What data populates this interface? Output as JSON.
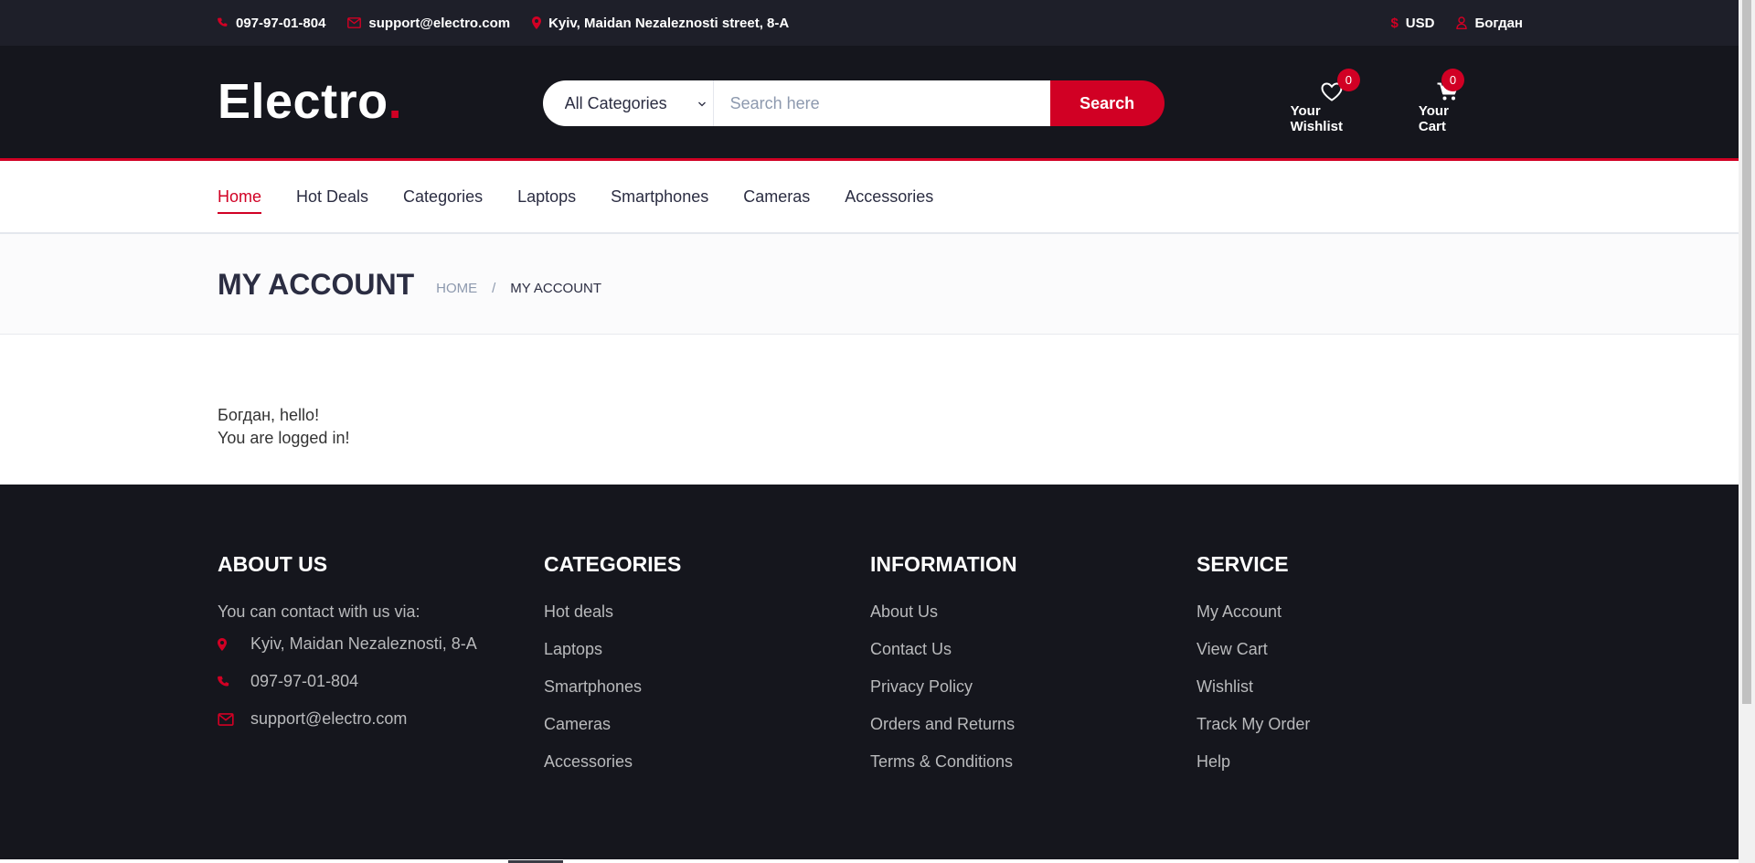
{
  "top_bar": {
    "phone": "097-97-01-804",
    "email": "support@electro.com",
    "address": "Kyiv, Maidan Nezaleznosti street, 8-A",
    "currency": "USD",
    "user": "Богдан"
  },
  "header": {
    "logo_text": "Electro",
    "logo_dot": ".",
    "search": {
      "category_selected": "All Categories",
      "placeholder": "Search here",
      "button_label": "Search"
    },
    "wishlist": {
      "label": "Your Wishlist",
      "count": "0"
    },
    "cart": {
      "label": "Your Cart",
      "count": "0"
    }
  },
  "nav": {
    "items": [
      {
        "label": "Home",
        "active": true
      },
      {
        "label": "Hot Deals"
      },
      {
        "label": "Categories"
      },
      {
        "label": "Laptops"
      },
      {
        "label": "Smartphones"
      },
      {
        "label": "Cameras"
      },
      {
        "label": "Accessories"
      }
    ]
  },
  "breadcrumb": {
    "title": "MY ACCOUNT",
    "home": "HOME",
    "separator": "/",
    "current": "MY ACCOUNT"
  },
  "main": {
    "greeting": "Богдан, hello!",
    "status": "You are logged in!"
  },
  "footer": {
    "about": {
      "title": "ABOUT US",
      "intro": "You can contact with us via:",
      "address": "Kyiv, Maidan Nezaleznosti, 8-A",
      "phone": "097-97-01-804",
      "email": "support@electro.com"
    },
    "categories": {
      "title": "CATEGORIES",
      "links": [
        "Hot deals",
        "Laptops",
        "Smartphones",
        "Cameras",
        "Accessories"
      ]
    },
    "information": {
      "title": "INFORMATION",
      "links": [
        "About Us",
        "Contact Us",
        "Privacy Policy",
        "Orders and Returns",
        "Terms & Conditions"
      ]
    },
    "service": {
      "title": "SERVICE",
      "links": [
        "My Account",
        "View Cart",
        "Wishlist",
        "Track My Order",
        "Help"
      ]
    }
  },
  "colors": {
    "accent": "#D10024",
    "header_bg": "#15161D",
    "top_bar_bg": "#1E1F29"
  }
}
